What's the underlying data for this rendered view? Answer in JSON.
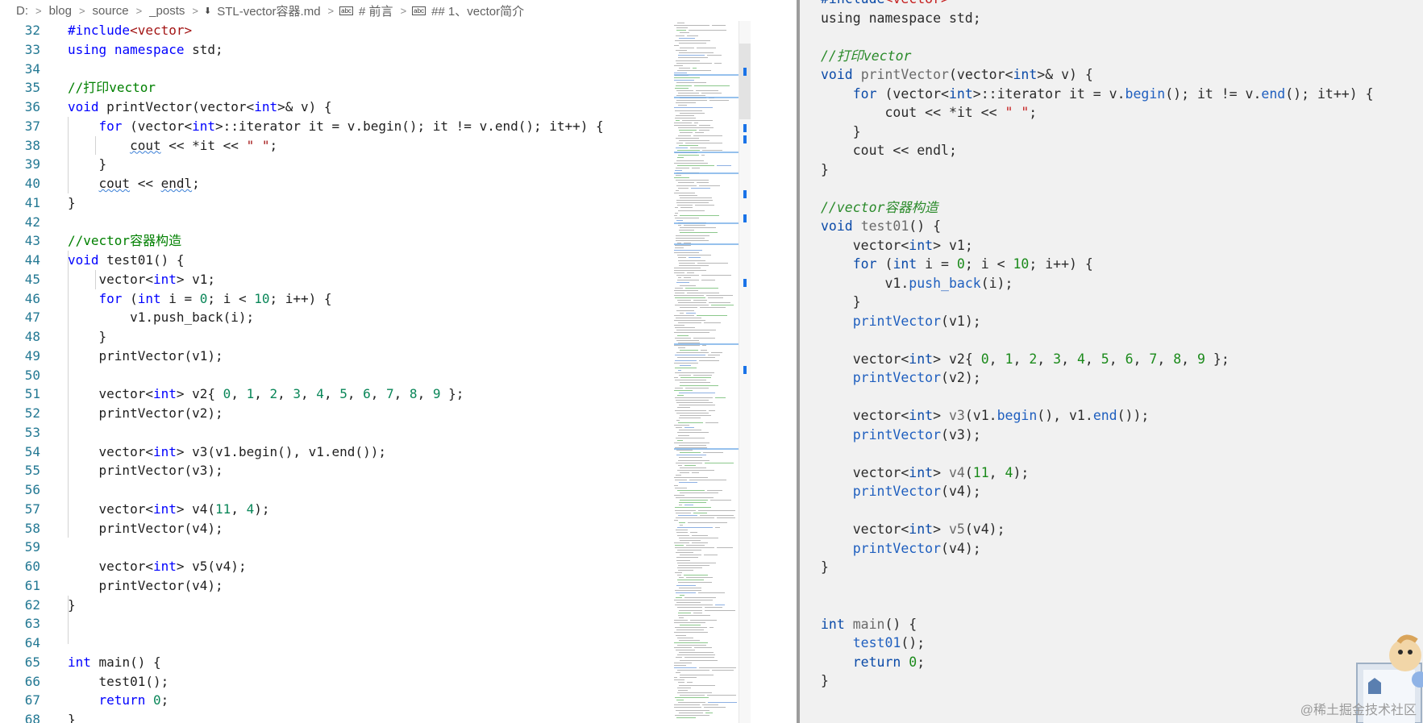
{
  "breadcrumb": {
    "items": [
      "D:",
      "blog",
      "source",
      "_posts",
      "STL-vector容器.md",
      "# 前言",
      "## 1、vector简介"
    ]
  },
  "left_editor": {
    "line_numbers": [
      "32",
      "33",
      "34",
      "35",
      "36",
      "37",
      "38",
      "39",
      "40",
      "41",
      "42",
      "43",
      "44",
      "45",
      "46",
      "47",
      "48",
      "49",
      "50",
      "51",
      "52",
      "53",
      "54",
      "55",
      "56",
      "57",
      "58",
      "59",
      "60",
      "61",
      "62",
      "63",
      "64",
      "65",
      "66",
      "67",
      "68"
    ]
  },
  "right_panel": {
    "watermark": "@稀土掘金技术社区"
  },
  "colors": {
    "keyword": "#0000ff",
    "number": "#098658",
    "string": "#a31515",
    "comment": "#008000",
    "line_number": "#237893"
  }
}
